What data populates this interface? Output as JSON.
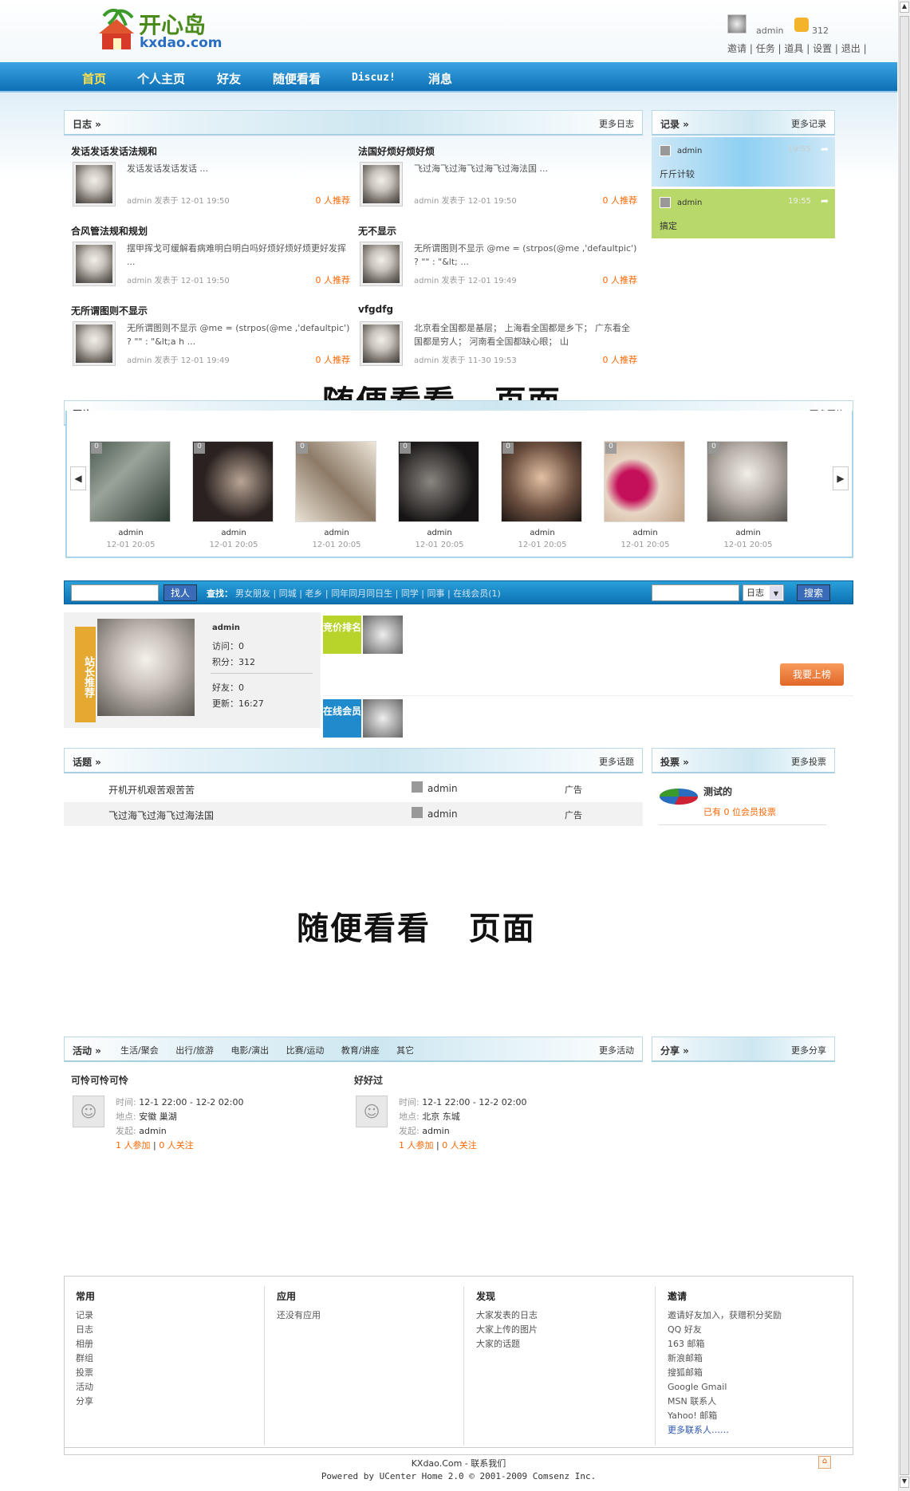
{
  "site": {
    "logo_cn": "开心岛",
    "logo_en": "kxdao.com"
  },
  "user": {
    "name": "admin",
    "points": "312",
    "links": [
      "邀请",
      "任务",
      "道具",
      "设置",
      "退出"
    ]
  },
  "nav": [
    "首页",
    "个人主页",
    "好友",
    "随便看看",
    "Discuz!",
    "消息"
  ],
  "blog": {
    "title": "日志 »",
    "more": "更多日志",
    "items": [
      {
        "title": "发话发话发话法规和",
        "summary": "发话发话发话发话 ...",
        "meta": "admin 发表于 12-01 19:50",
        "rec": "0 人推荐"
      },
      {
        "title": "法国好烦好烦好烦",
        "summary": "飞过海飞过海飞过海飞过海法国 ...",
        "meta": "admin 发表于 12-01 19:50",
        "rec": "0 人推荐"
      },
      {
        "title": "合风管法规和规划",
        "summary": "摆甲挥戈可缓解看病难明白明白吗好烦好烦好烦更好发挥 ...",
        "meta": "admin 发表于 12-01 19:50",
        "rec": "0 人推荐"
      },
      {
        "title": "无不显示",
        "summary": "无所谓图则不显示 @me = (strpos(@me ,'defaultpic') ? \"\" : \"&lt; ...",
        "meta": "admin 发表于 12-01 19:49",
        "rec": "0 人推荐"
      },
      {
        "title": "无所谓图则不显示",
        "summary": "无所谓图则不显示 @me = (strpos(@me ,'defaultpic') ? \"\" : \"&lt;a h ...",
        "meta": "admin 发表于 12-01 19:49",
        "rec": "0 人推荐"
      },
      {
        "title": "vfgdfg",
        "summary": "北京看全国都是基层； 上海看全国都是乡下； 广东看全国都是穷人； 河南看全国都缺心眼； 山",
        "meta": "admin 发表于 11-30 19:53",
        "rec": "0 人推荐"
      }
    ]
  },
  "record": {
    "title": "记录 »",
    "more": "更多记录",
    "items": [
      {
        "user": "admin",
        "time": "19:55",
        "text": "斤斤计较"
      },
      {
        "user": "admin",
        "time": "19:55",
        "text": "搞定"
      }
    ]
  },
  "overlay_text": "随便看看   页面",
  "photos": {
    "title": "图片 »",
    "more": "更多图片",
    "items": [
      {
        "author": "admin",
        "date": "12-01 20:05",
        "count": "0"
      },
      {
        "author": "admin",
        "date": "12-01 20:05",
        "count": "0"
      },
      {
        "author": "admin",
        "date": "12-01 20:05",
        "count": "0"
      },
      {
        "author": "admin",
        "date": "12-01 20:05",
        "count": "0"
      },
      {
        "author": "admin",
        "date": "12-01 20:05",
        "count": "0"
      },
      {
        "author": "admin",
        "date": "12-01 20:05",
        "count": "0"
      },
      {
        "author": "admin",
        "date": "12-01 20:05",
        "count": "0"
      }
    ]
  },
  "search": {
    "find_btn": "找人",
    "label": "查找：",
    "links": [
      "男女朋友",
      "同城",
      "老乡",
      "同年同月同日生",
      "同学",
      "同事",
      "在线会员(1)"
    ],
    "select": "日志",
    "search_btn": "搜索"
  },
  "recommend": {
    "tag": "站长推荐",
    "name": "admin",
    "visits": "访问：0",
    "points": "积分：312",
    "friends": "好友：0",
    "updated": "更新：16:27",
    "bid_tag": "竞价排名",
    "online_tag": "在线会员",
    "bid_btn": "我要上榜"
  },
  "threads": {
    "title": "话题 »",
    "more": "更多话题",
    "items": [
      {
        "title": "开机开机艰苦艰苦苦",
        "user": "admin",
        "forum": "广告"
      },
      {
        "title": "飞过海飞过海飞过海法国",
        "user": "admin",
        "forum": "广告"
      }
    ]
  },
  "poll": {
    "title": "投票 »",
    "more": "更多投票",
    "name": "测试的",
    "voters": "已有 0 位会员投票"
  },
  "events": {
    "title": "活动 »",
    "tabs": [
      "生活/聚会",
      "出行/旅游",
      "电影/演出",
      "比赛/运动",
      "教育/讲座",
      "其它"
    ],
    "more": "更多活动",
    "items": [
      {
        "title": "可怜可怜可怜",
        "time_label": "时间:",
        "time": "12-1 22:00 - 12-2 02:00",
        "place_label": "地点:",
        "place": "安徽 巢湖",
        "host_label": "发起:",
        "host": "admin",
        "join": "1 人参加",
        "follow": "0 人关注"
      },
      {
        "title": "好好过",
        "time_label": "时间:",
        "time": "12-1 22:00 - 12-2 02:00",
        "place_label": "地点:",
        "place": "北京 东城",
        "host_label": "发起:",
        "host": "admin",
        "join": "1 人参加",
        "follow": "0 人关注"
      }
    ]
  },
  "share": {
    "title": "分享 »",
    "more": "更多分享"
  },
  "footer": {
    "cols": [
      {
        "h": "常用",
        "items": [
          "记录",
          "日志",
          "相册",
          "群组",
          "投票",
          "活动",
          "分享"
        ]
      },
      {
        "h": "应用",
        "items": [
          "还没有应用"
        ]
      },
      {
        "h": "发现",
        "items": [
          "大家发表的日志",
          "大家上传的图片",
          "大家的话题"
        ]
      },
      {
        "h": "邀请",
        "items": [
          "邀请好友加入，获赠积分奖励",
          "QQ 好友",
          "163 邮箱",
          "新浪邮箱",
          "搜狐邮箱",
          "Google Gmail",
          "MSN 联系人",
          "Yahoo! 邮箱",
          "更多联系人……"
        ]
      }
    ],
    "line1": "KXdao.Com - 联系我们",
    "line2": "Powered by UCenter Home 2.0 © 2001-2009 Comsenz Inc."
  },
  "colors": {
    "nav": "#1f8bcc",
    "accent": "#ff6600",
    "green": "#a8cc4a"
  }
}
